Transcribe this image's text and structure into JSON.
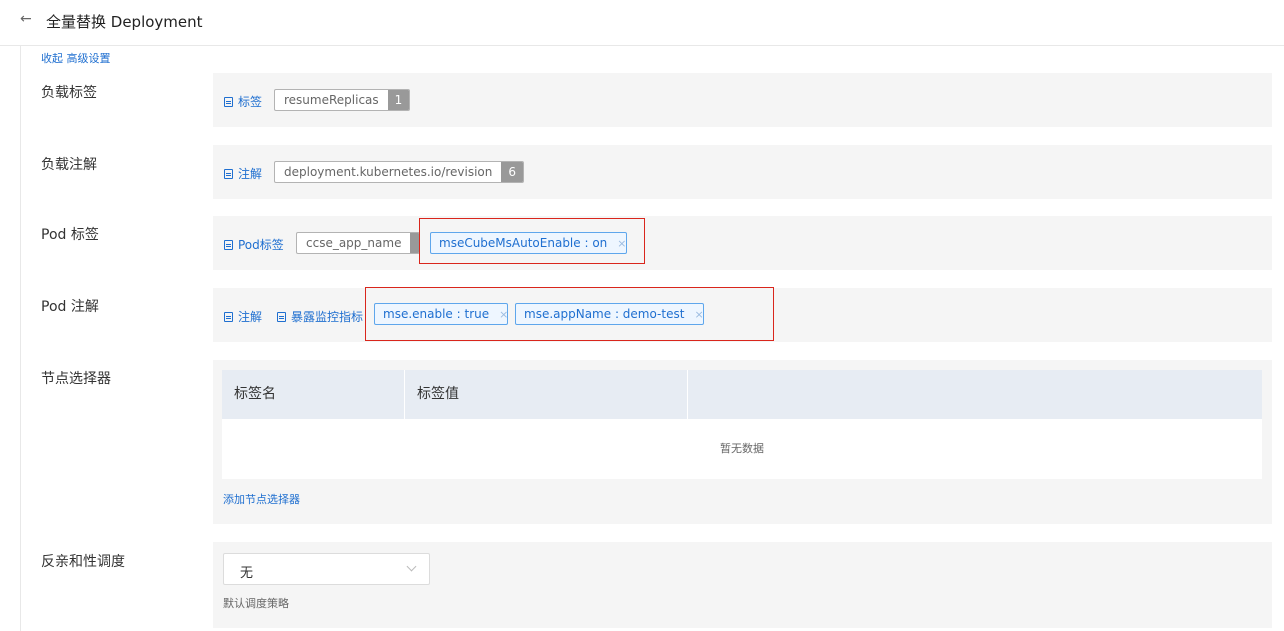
{
  "header": {
    "back_glyph": "←",
    "title": "全量替换 Deployment"
  },
  "collapse_link": "收起 高级设置",
  "workload_labels": {
    "label": "负载标签",
    "link": "标签",
    "tag": {
      "text": "resumeReplicas",
      "count": "1"
    }
  },
  "workload_annotations": {
    "label": "负载注解",
    "link": "注解",
    "tag": {
      "text": "deployment.kubernetes.io/revision",
      "count": "6"
    }
  },
  "pod_labels": {
    "label": "Pod 标签",
    "link": "Pod标签",
    "tag": {
      "text": "ccse_app_name"
    },
    "chips": [
      {
        "text": "mseCubeMsAutoEnable : on",
        "close": "×"
      }
    ]
  },
  "pod_annotations": {
    "label": "Pod 注解",
    "link_annotation": "注解",
    "link_metrics": "暴露监控指标",
    "chips": [
      {
        "text": "mse.enable : true",
        "close": "×"
      },
      {
        "text": "mse.appName : demo-test",
        "close": "×"
      }
    ]
  },
  "node_selector": {
    "label": "节点选择器",
    "columns": [
      "标签名",
      "标签值"
    ],
    "empty_text": "暂无数据",
    "add_link": "添加节点选择器"
  },
  "anti_affinity": {
    "label": "反亲和性调度",
    "selected": "无",
    "hint": "默认调度策略"
  },
  "colors": {
    "link": "#1f6fd0",
    "highlight": "#d9261c",
    "panel_bg": "#f5f5f5"
  }
}
